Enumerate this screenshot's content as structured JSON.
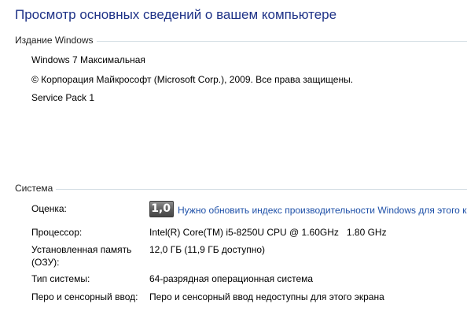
{
  "page": {
    "title": "Просмотр основных сведений о вашем компьютере"
  },
  "edition": {
    "section_label": "Издание Windows",
    "name": "Windows 7 Максимальная",
    "copyright": "© Корпорация Майкрософт (Microsoft Corp.), 2009. Все права защищены.",
    "service_pack": "Service Pack 1"
  },
  "system": {
    "section_label": "Система",
    "rating": {
      "label": "Оценка:",
      "score": "1,0",
      "link_text": "Нужно обновить индекс производительности Windows для этого к"
    },
    "processor": {
      "label": "Процессор:",
      "value": "Intel(R) Core(TM) i5-8250U CPU @ 1.60GHz   1.80 GHz"
    },
    "memory": {
      "label": "Установленная память (ОЗУ):",
      "value": "12,0 ГБ (11,9 ГБ доступно)"
    },
    "system_type": {
      "label": "Тип системы:",
      "value": "64-разрядная операционная система"
    },
    "pen_touch": {
      "label": "Перо и сенсорный ввод:",
      "value": "Перо и сенсорный ввод недоступны для этого экрана"
    }
  },
  "colors": {
    "title": "#1e3287",
    "link": "#1e50a8",
    "divider": "#d5dfe5"
  }
}
